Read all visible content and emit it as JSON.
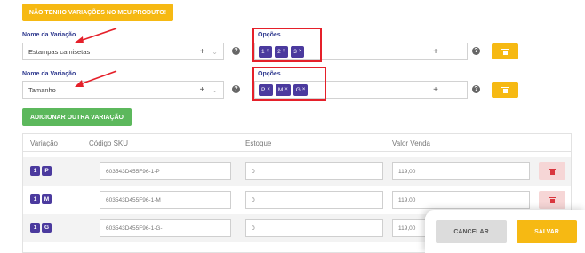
{
  "no_variation_button": "NÃO TENHO VARIAÇÕES NO MEU PRODUTO!",
  "variations": [
    {
      "name_label": "Nome da Variação",
      "name_value": "Estampas camisetas",
      "options_label": "Opções",
      "options": [
        "1",
        "2",
        "3"
      ]
    },
    {
      "name_label": "Nome da Variação",
      "name_value": "Tamanho",
      "options_label": "Opções",
      "options": [
        "P",
        "M",
        "G"
      ]
    }
  ],
  "add_variation_button": "ADICIONAR OUTRA VARIAÇÃO",
  "table": {
    "headers": [
      "Variação",
      "Código SKU",
      "Estoque",
      "Valor Venda"
    ],
    "rows": [
      {
        "badges": [
          "1",
          "P"
        ],
        "sku": "603543D455F96-1-P",
        "stock": "0",
        "price": "119,00"
      },
      {
        "badges": [
          "1",
          "M"
        ],
        "sku": "603543D455F96-1-M",
        "stock": "0",
        "price": "119,00"
      },
      {
        "badges": [
          "1",
          "G"
        ],
        "sku": "603543D455F96-1-G-",
        "stock": "0",
        "price": "119,00"
      }
    ]
  },
  "footer": {
    "cancel": "CANCELAR",
    "save": "SALVAR"
  },
  "icons": {
    "plus": "+",
    "caret": "⌄",
    "help": "?",
    "remove": "×"
  },
  "colors": {
    "warning": "#f6b913",
    "success": "#5cb85c",
    "tag": "#4b3a9e",
    "highlight": "#e5202a",
    "label": "#2f3a8f"
  }
}
